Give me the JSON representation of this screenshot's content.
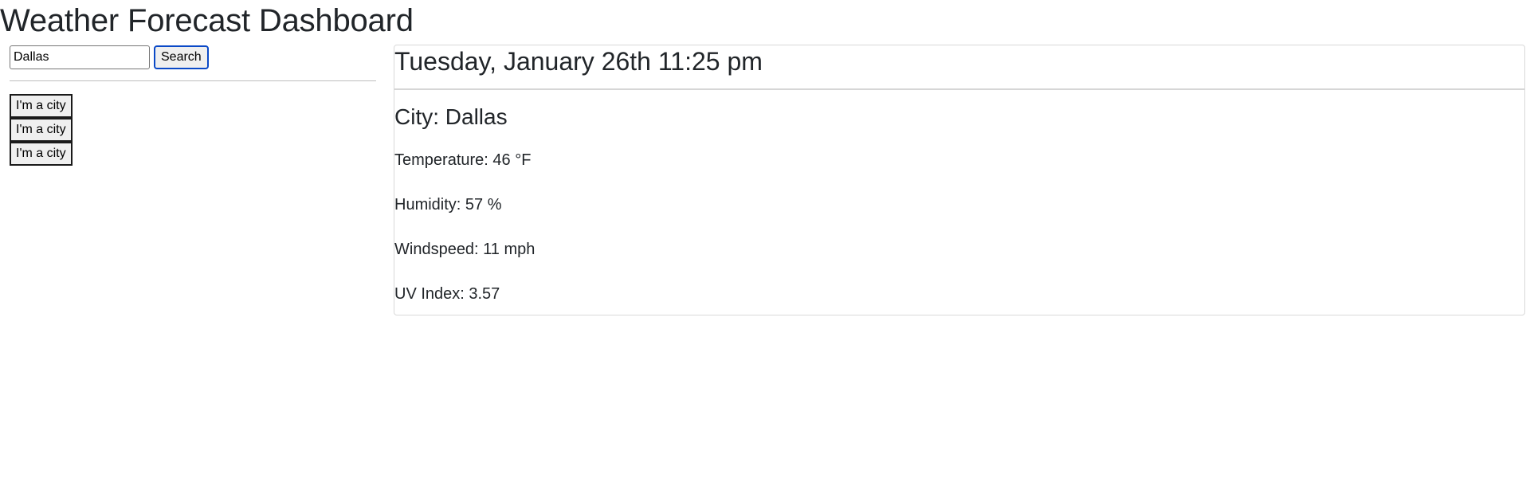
{
  "header": {
    "title": "Weather Forecast Dashboard"
  },
  "search": {
    "value": "Dallas",
    "button_label": "Search"
  },
  "city_history": [
    {
      "label": "I'm a city"
    },
    {
      "label": "I'm a city"
    },
    {
      "label": "I'm a city"
    }
  ],
  "weather": {
    "date": "Tuesday, January 26th 11:25 pm",
    "city": "City: Dallas",
    "temperature": "Temperature: 46 °F",
    "humidity": "Humidity: 57 %",
    "windspeed": "Windspeed: 11 mph",
    "uv_index": "UV Index: 3.57"
  },
  "colors": {
    "text": "#212529",
    "search_button_border": "#0a49c7",
    "card_border": "#d9d9d9",
    "button_bg": "#efefef"
  }
}
